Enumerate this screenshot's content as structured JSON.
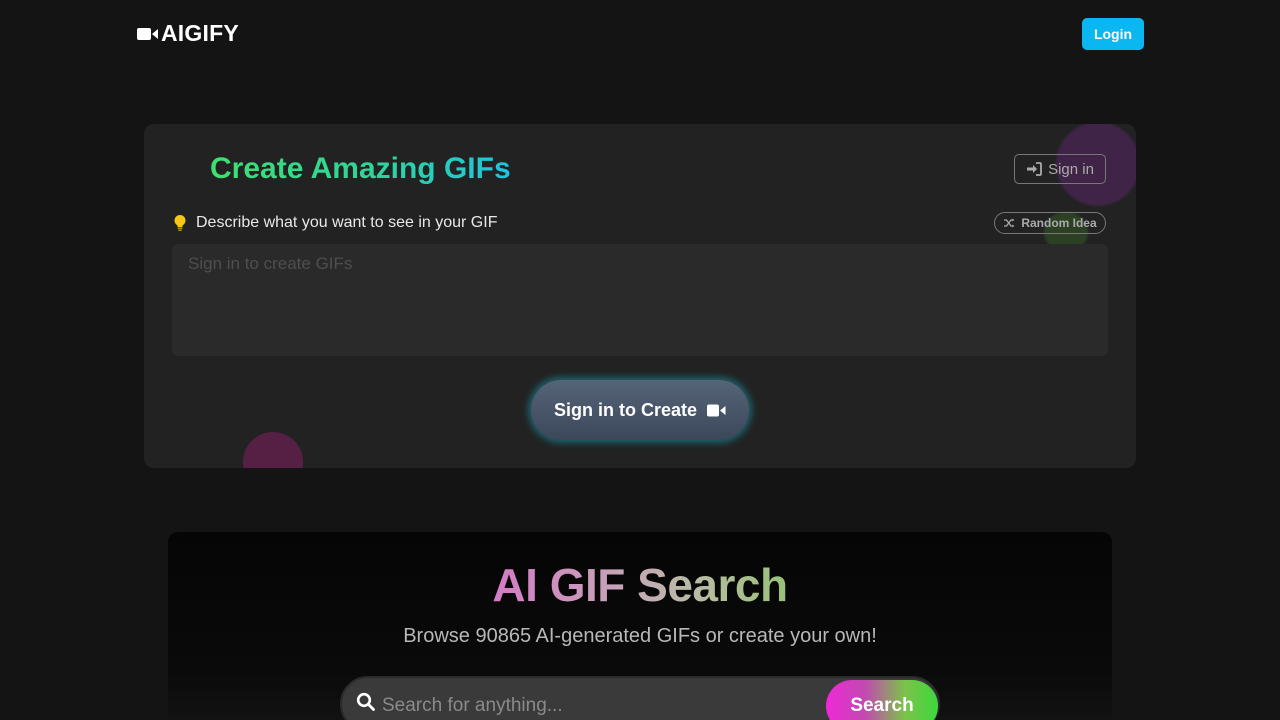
{
  "header": {
    "logo_text": "AIGIFY",
    "logo_icon": "video-camera-icon",
    "login_label": "Login",
    "login_color": "#0bb7f0"
  },
  "create": {
    "title": "Create Amazing GIFs",
    "signin_label": "Sign in",
    "signin_icon": "sign-in-icon",
    "prompt_label": "Describe what you want to see in your GIF",
    "prompt_icon": "lightbulb-icon",
    "random_label": "Random Idea",
    "random_icon": "shuffle-icon",
    "prompt_placeholder": "Sign in to create GIFs",
    "prompt_value": "",
    "create_button_label": "Sign in to Create",
    "create_button_icon": "video-camera-icon",
    "title_gradient": [
      "#3ee070",
      "#1fc3e0"
    ]
  },
  "search": {
    "title": "AI GIF Search",
    "subtitle": "Browse 90865 AI-generated GIFs or create your own!",
    "input_placeholder": "Search for anything...",
    "input_value": "",
    "button_label": "Search",
    "icon": "search-icon"
  }
}
